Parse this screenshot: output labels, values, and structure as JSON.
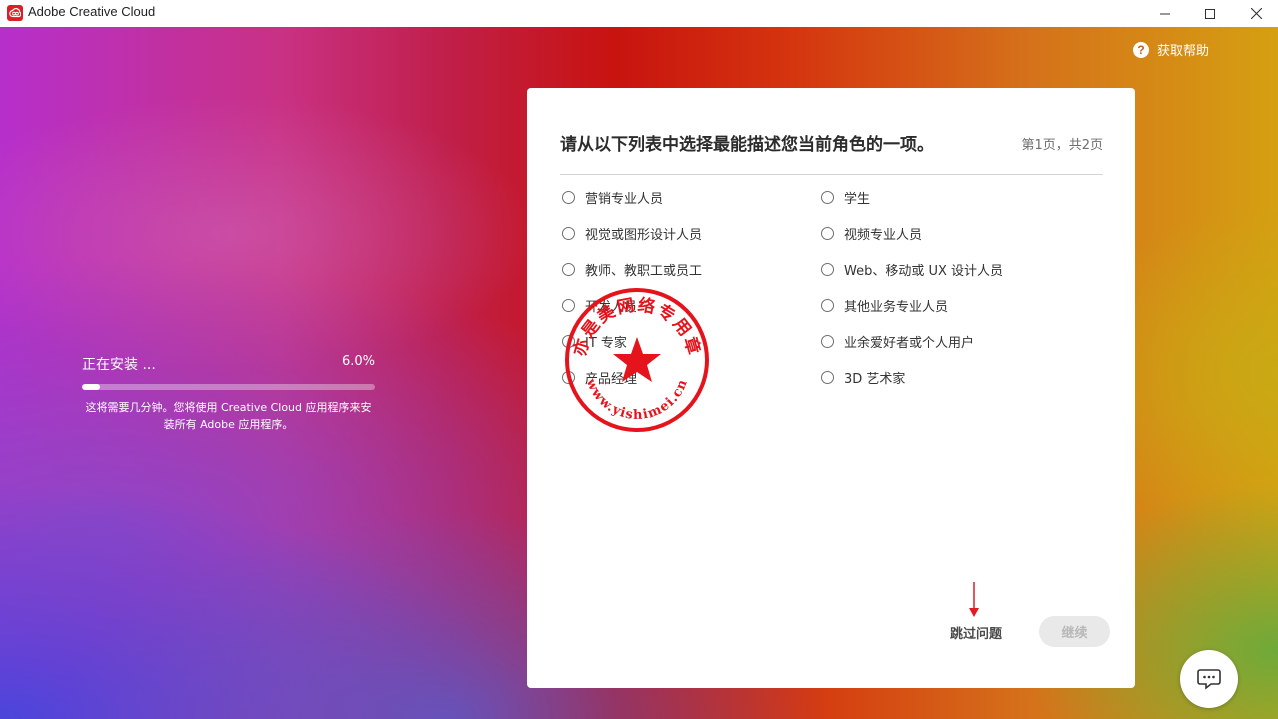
{
  "window": {
    "title": "Adobe Creative Cloud",
    "controls": [
      "minimize-icon",
      "maximize-icon",
      "close-icon"
    ]
  },
  "help": {
    "label": "获取帮助",
    "icon_glyph": "?",
    "icon": "help-circle-icon"
  },
  "install": {
    "status": "正在安装 ...",
    "percent_text": "6.0%",
    "progress_fraction": 0.06,
    "description_line1": "这将需要几分钟。您将使用 Creative Cloud 应用程序来安",
    "description_line2": "装所有 Adobe 应用程序。"
  },
  "survey": {
    "question": "请从以下列表中选择最能描述您当前角色的一项。",
    "page_indicator": "第1页，共2页",
    "options_left": [
      "营销专业人员",
      "视觉或图形设计人员",
      "教师、教职工或员工",
      "开发人员",
      "IT 专家",
      "产品经理"
    ],
    "options_right": [
      "学生",
      "视频专业人员",
      "Web、移动或 UX 设计人员",
      "其他业务专业人员",
      "业余爱好者或个人用户",
      "3D 艺术家"
    ],
    "skip_label": "跳过问题",
    "continue_label": "继续"
  },
  "stamp": {
    "text": "亦是美网络专用章",
    "url": "www.yishimei.cn"
  },
  "chat": {
    "icon": "chat-bubble-icon"
  },
  "colors": {
    "adobe_red": "#da1f26",
    "stamp_red": "#e5141c",
    "disabled_button": "#e9e9e9"
  }
}
